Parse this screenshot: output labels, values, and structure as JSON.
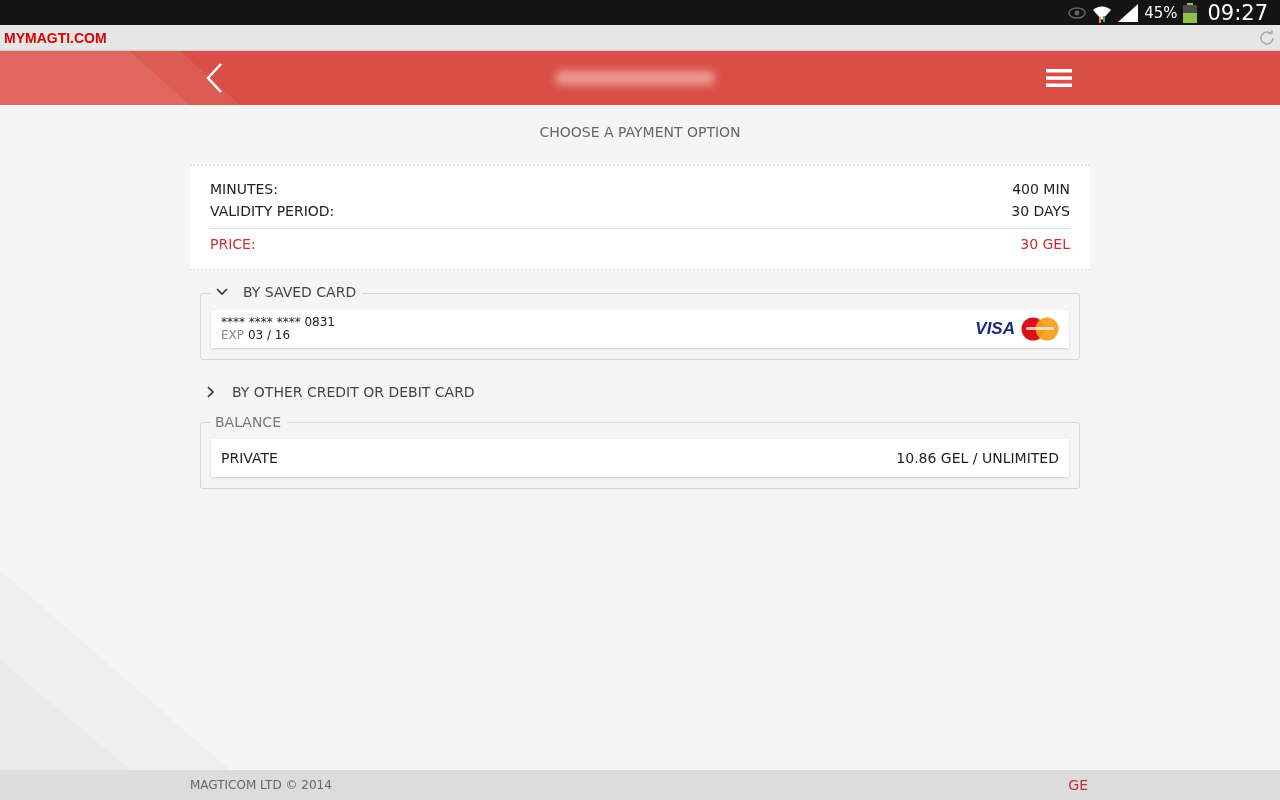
{
  "status_bar": {
    "battery": "45%",
    "time": "09:27"
  },
  "browser": {
    "url": "MYMAGTI.COM"
  },
  "heading": "CHOOSE A PAYMENT OPTION",
  "summary": {
    "rows": [
      {
        "label": "MINUTES:",
        "value": "400 MIN"
      },
      {
        "label": "VALIDITY PERIOD:",
        "value": "30 DAYS"
      }
    ],
    "price": {
      "label": "PRICE:",
      "value": "30 GEL"
    }
  },
  "sections": [
    {
      "kind": "collapsible",
      "title": "BY SAVED CARD",
      "expanded": true,
      "card": {
        "number": "**** **** **** 0831",
        "exp_label": "EXP",
        "exp": "03 / 16",
        "brand": "VISA"
      }
    },
    {
      "kind": "collapsible",
      "title": "BY OTHER CREDIT OR DEBIT CARD",
      "expanded": false
    },
    {
      "kind": "group",
      "title": "BALANCE",
      "row": {
        "label": "PRIVATE",
        "value": "10.86 GEL / UNLIMITED"
      }
    }
  ],
  "footer": {
    "copyright": "MAGTICOM LTD © 2014",
    "language": "GE"
  }
}
